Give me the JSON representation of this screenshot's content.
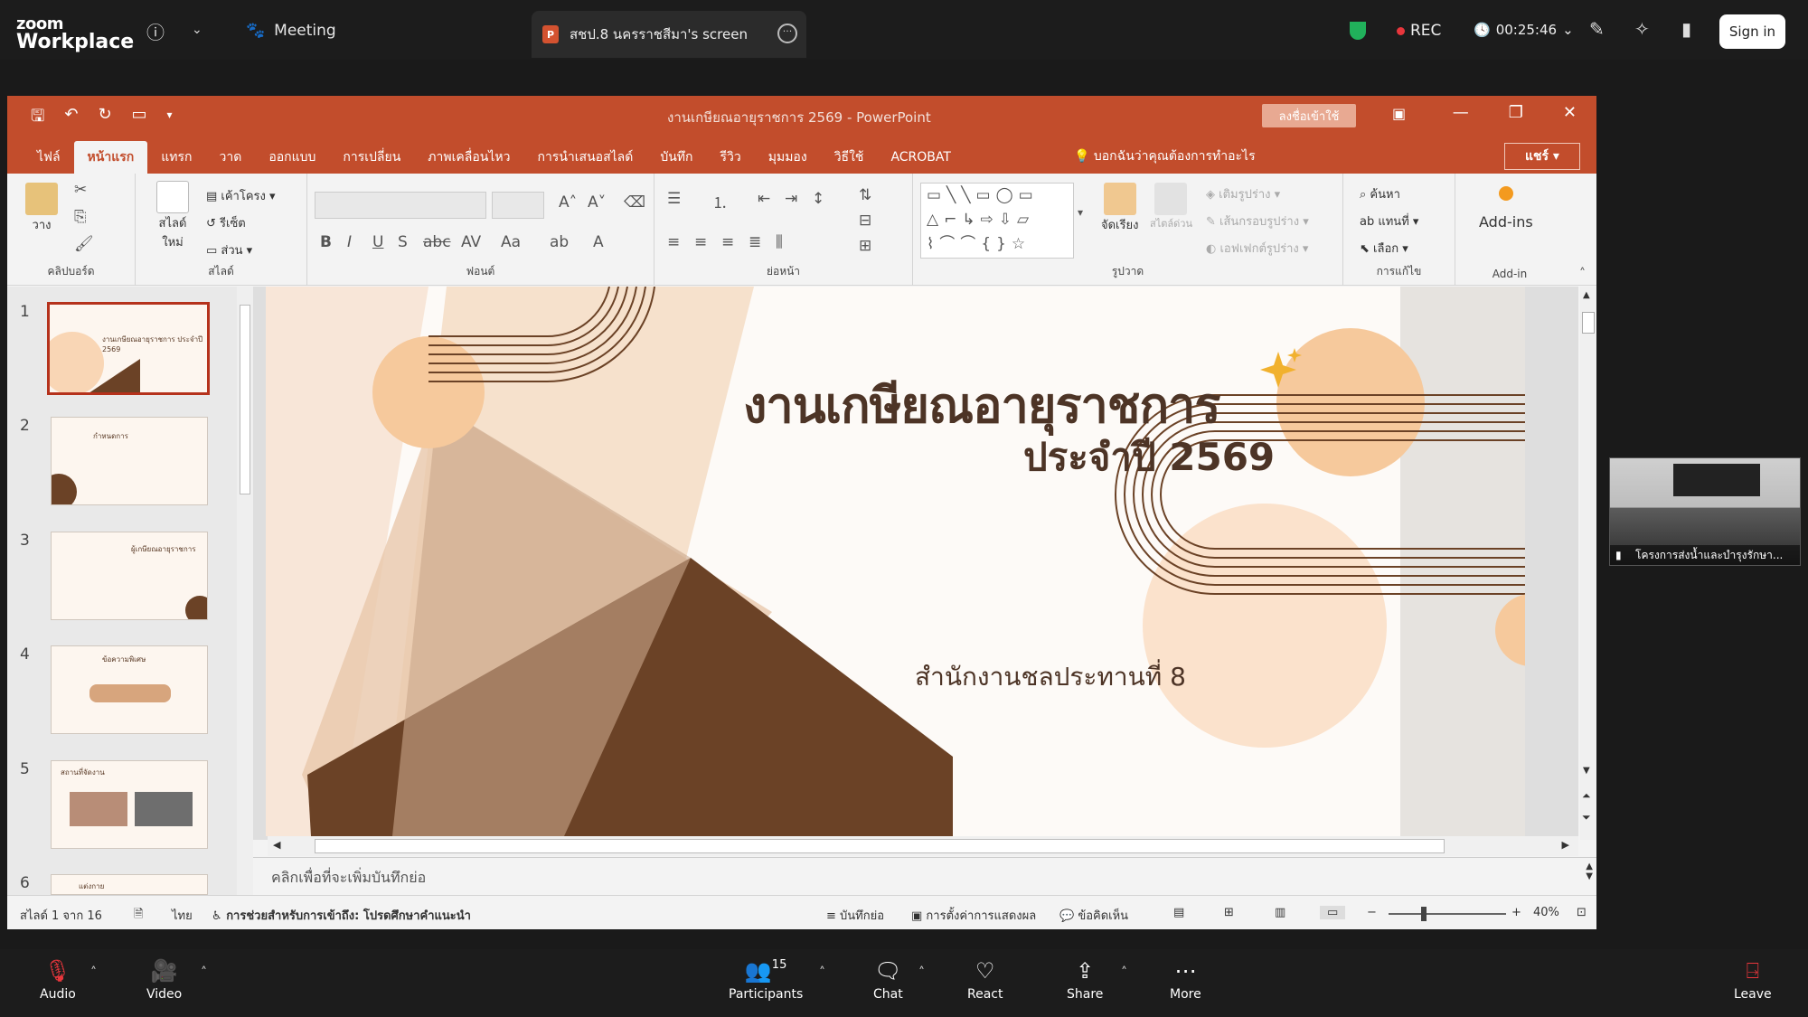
{
  "zoom": {
    "logo_top": "zoom",
    "logo_bottom": "Workplace",
    "meeting_label": "Meeting",
    "share_tab_label": "สชป.8 นครราชสีมา's screen",
    "rec_label": "REC",
    "timer": "00:25:46",
    "signin_label": "Sign in",
    "bottom": {
      "audio": "Audio",
      "video": "Video",
      "participants": "Participants",
      "participants_count": "15",
      "chat": "Chat",
      "react": "React",
      "share": "Share",
      "more": "More",
      "leave": "Leave"
    },
    "video_tile_name": "โครงการส่งน้ำและบำรุงรักษา..."
  },
  "ppt": {
    "window_title": "งานเกษียณอายุราชการ 2569  -  PowerPoint",
    "signin_label": "ลงชื่อเข้าใช้",
    "share_label": "แชร์",
    "tell_me": "บอกฉันว่าคุณต้องการทำอะไร",
    "tabs": [
      "ไฟล์",
      "หน้าแรก",
      "แทรก",
      "วาด",
      "ออกแบบ",
      "การเปลี่ยน",
      "ภาพเคลื่อนไหว",
      "การนำเสนอสไลด์",
      "บันทึก",
      "รีวิว",
      "มุมมอง",
      "วิธีใช้",
      "ACROBAT"
    ],
    "ribbon": {
      "clipboard_label": "คลิปบอร์ด",
      "paste": "วาง",
      "slides_label": "สไลด์",
      "new_slide": "สไลด์ใหม่",
      "layout": "เค้าโครง",
      "reset": "รีเซ็ต",
      "section": "ส่วน",
      "font_label": "ฟอนต์",
      "paragraph_label": "ย่อหน้า",
      "drawing_label": "รูปวาด",
      "arrange": "จัดเรียง",
      "quick_styles": "สไตล์ด่วน",
      "shape_fill": "เติมรูปร่าง",
      "shape_outline": "เส้นกรอบรูปร่าง",
      "shape_effects": "เอฟเฟกต์รูปร่าง",
      "editing_label": "การแก้ไข",
      "find": "ค้นหา",
      "replace": "แทนที่",
      "select": "เลือก",
      "addins_btn": "Add-ins",
      "addins_label": "Add-in"
    },
    "thumb_numbers": [
      "1",
      "2",
      "3",
      "4",
      "5",
      "6"
    ],
    "thumbs_text": [
      "งานเกษียณอายุราชการ ประจำปี 2569",
      "กำหนดการ",
      "ผู้เกษียณอายุราชการ",
      "ข้อความพิเศษ",
      "สถานที่จัดงาน",
      "แต่งกาย"
    ],
    "slide": {
      "title": "งานเกษียณอายุราชการ",
      "subtitle": "ประจำปี 2569",
      "office": "สำนักงานชลประทานที่ 8"
    },
    "notes_placeholder": "คลิกเพื่อที่จะเพิ่มบันทึกย่อ",
    "status": {
      "slide_count": "สไลด์ 1 จาก 16",
      "language": "ไทย",
      "accessibility": "การช่วยสำหรับการเข้าถึง: โปรดศึกษาคำแนะนำ",
      "notes": "บันทึกย่อ",
      "display_settings": "การตั้งค่าการแสดงผล",
      "comments": "ข้อคิดเห็น",
      "zoom": "40%"
    }
  },
  "colors": {
    "ppt_accent": "#c24d2c",
    "slide_brown": "#6b4226",
    "slide_peach": "#f6c99c"
  }
}
